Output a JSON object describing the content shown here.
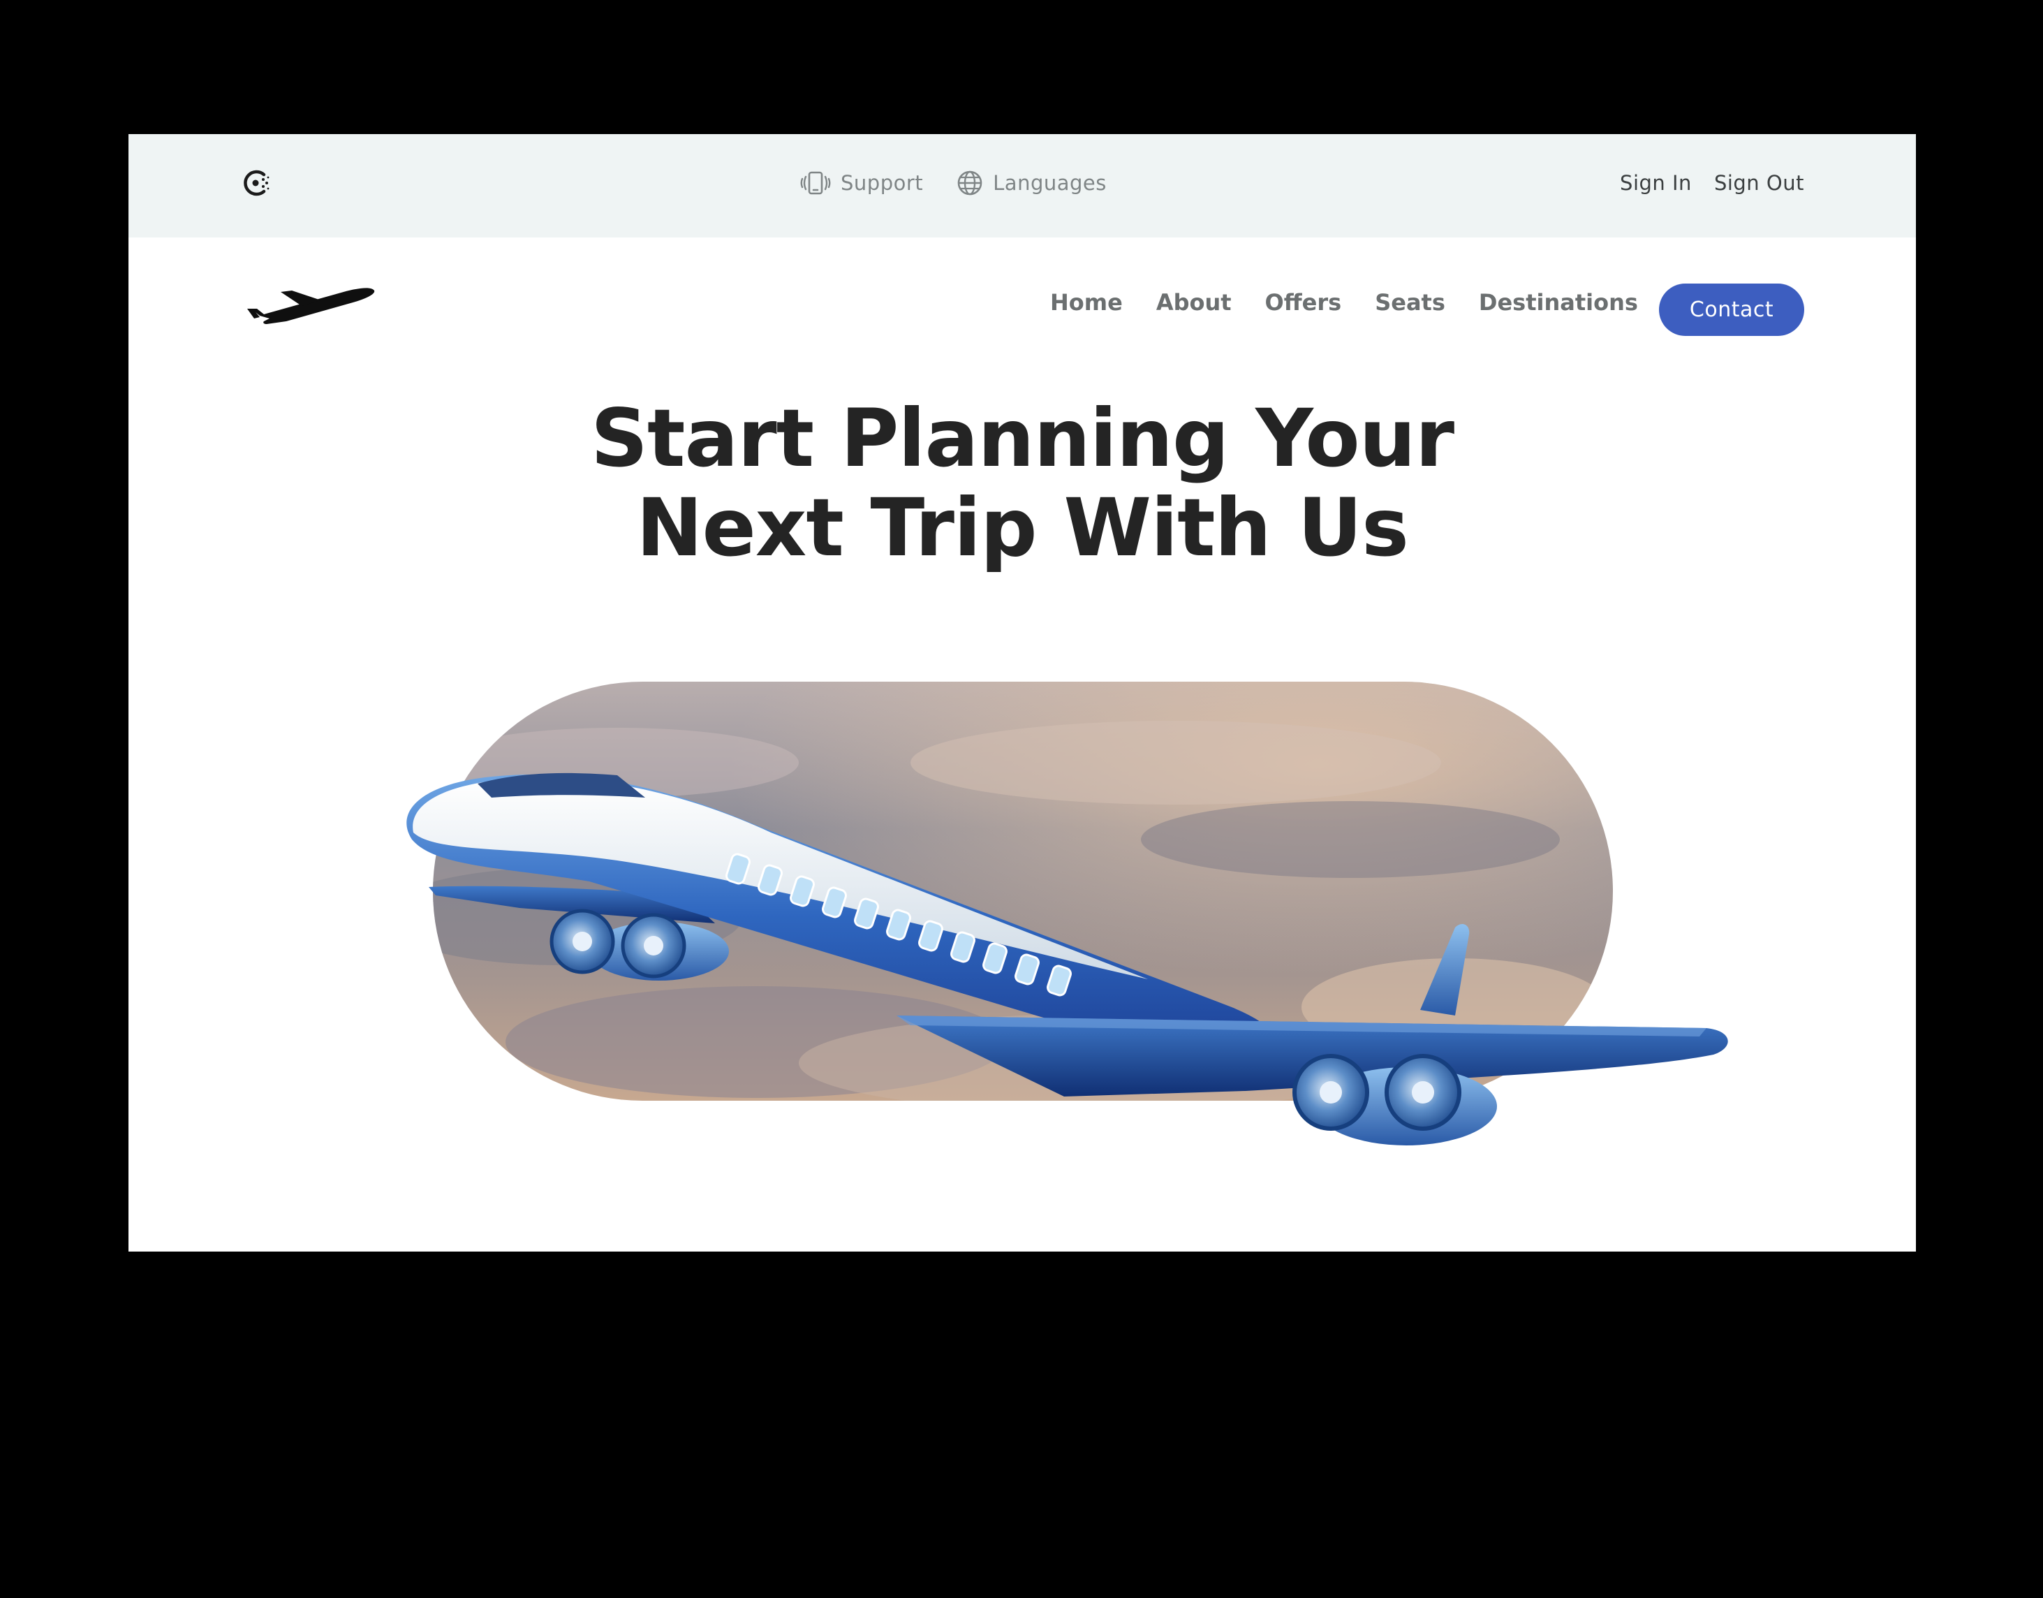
{
  "topbar": {
    "brand_icon": "circle-dot-logo-icon",
    "support": {
      "label": "Support",
      "icon": "phone-vibrate-icon"
    },
    "languages": {
      "label": "Languages",
      "icon": "globe-icon"
    },
    "sign_in": "Sign In",
    "sign_out": "Sign Out"
  },
  "nav": {
    "logo_icon": "airplane-logo-icon",
    "items": [
      {
        "label": "Home"
      },
      {
        "label": "About"
      },
      {
        "label": "Offers"
      },
      {
        "label": "Seats"
      },
      {
        "label": "Destinations"
      }
    ],
    "contact": "Contact"
  },
  "hero": {
    "title_line1": "Start Planning Your",
    "title_line2": "Next Trip With Us",
    "image": "airplane-over-clouds-illustration"
  },
  "colors": {
    "topbar_bg": "#eff4f4",
    "accent": "#3d5ec0",
    "heading": "#242424",
    "nav_text": "#6b6f70",
    "backdrop": "#000000"
  }
}
